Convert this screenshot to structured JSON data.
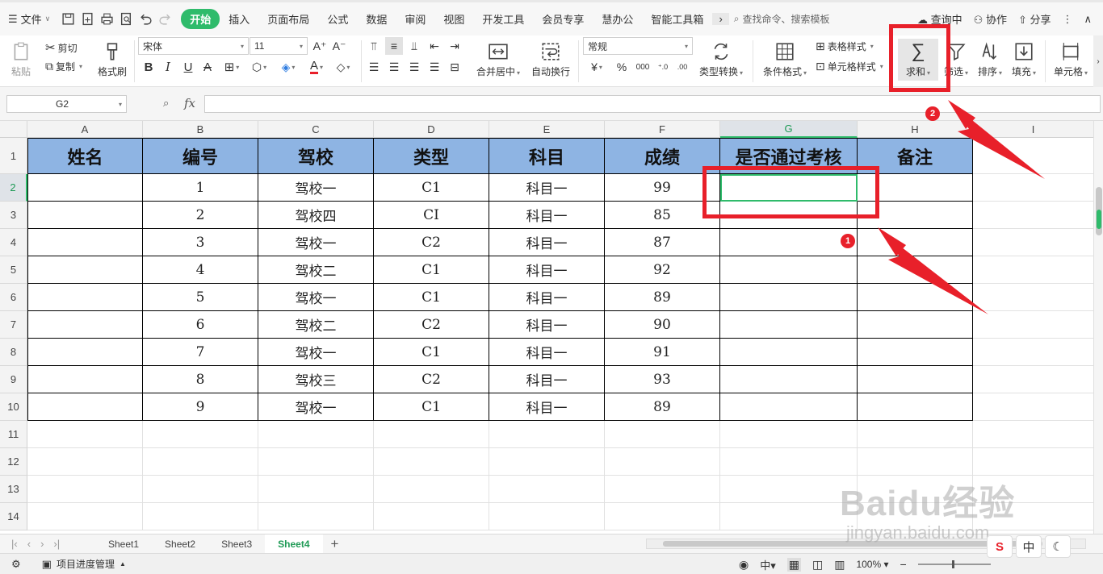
{
  "menu": {
    "file_label": "文件",
    "tabs": [
      "开始",
      "插入",
      "页面布局",
      "公式",
      "数据",
      "审阅",
      "视图",
      "开发工具",
      "会员专享",
      "慧办公",
      "智能工具箱"
    ],
    "search_placeholder": "查找命令、搜索模板",
    "query_label": "查询中",
    "collab_label": "协作",
    "share_label": "分享"
  },
  "ribbon": {
    "paste": "粘贴",
    "cut": "剪切",
    "copy": "复制",
    "format_painter": "格式刷",
    "font_name": "宋体",
    "font_size": "11",
    "merge_center": "合并居中",
    "wrap_text": "自动换行",
    "number_format": "常规",
    "type_convert": "类型转换",
    "cond_format": "条件格式",
    "table_style": "表格样式",
    "cell_style": "单元格样式",
    "sum": "求和",
    "filter": "筛选",
    "sort": "排序",
    "fill": "填充",
    "cell": "单元格"
  },
  "formula_bar": {
    "name_box": "G2",
    "fx": "fx",
    "formula": ""
  },
  "grid": {
    "columns": [
      "A",
      "B",
      "C",
      "D",
      "E",
      "F",
      "G",
      "H",
      "I"
    ],
    "active_column": "G",
    "active_row": 2,
    "header": [
      "姓名",
      "编号",
      "驾校",
      "类型",
      "科目",
      "成绩",
      "是否通过考核",
      "备注"
    ],
    "rows": [
      [
        "",
        "1",
        "驾校一",
        "C1",
        "科目一",
        "99",
        "",
        ""
      ],
      [
        "",
        "2",
        "驾校四",
        "CI",
        "科目一",
        "85",
        "",
        ""
      ],
      [
        "",
        "3",
        "驾校一",
        "C2",
        "科目一",
        "87",
        "",
        ""
      ],
      [
        "",
        "4",
        "驾校二",
        "C1",
        "科目一",
        "92",
        "",
        ""
      ],
      [
        "",
        "5",
        "驾校一",
        "C1",
        "科目一",
        "89",
        "",
        ""
      ],
      [
        "",
        "6",
        "驾校二",
        "C2",
        "科目一",
        "90",
        "",
        ""
      ],
      [
        "",
        "7",
        "驾校一",
        "C1",
        "科目一",
        "91",
        "",
        ""
      ],
      [
        "",
        "8",
        "驾校三",
        "C2",
        "科目一",
        "93",
        "",
        ""
      ],
      [
        "",
        "9",
        "驾校一",
        "C1",
        "科目一",
        "89",
        "",
        ""
      ]
    ],
    "row_numbers": [
      "1",
      "2",
      "3",
      "4",
      "5",
      "6",
      "7",
      "8",
      "9",
      "10",
      "11",
      "12",
      "13",
      "14"
    ]
  },
  "sheets": {
    "tabs": [
      "Sheet1",
      "Sheet2",
      "Sheet3",
      "Sheet4"
    ],
    "active": "Sheet4"
  },
  "status": {
    "project": "项目进度管理",
    "zoom": "100%"
  },
  "annotations": {
    "badge_1": "1",
    "badge_2": "2"
  },
  "watermark": {
    "brand": "Baidu经验",
    "url": "jingyan.baidu.com"
  },
  "ime": {
    "mode": "中"
  },
  "colors": {
    "accent_green": "#2fbb6b",
    "header_fill": "#8eb4e3",
    "annotation_red": "#e8202a"
  }
}
